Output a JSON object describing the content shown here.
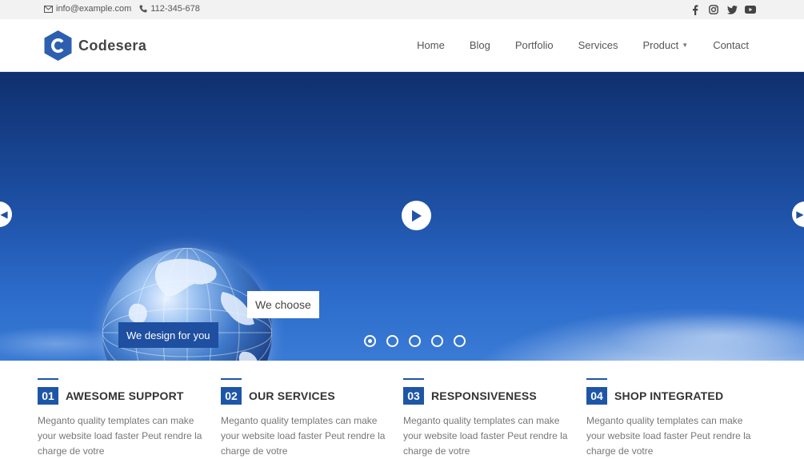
{
  "topbar": {
    "email": "info@example.com",
    "phone": "112-345-678",
    "social_icons": [
      "facebook-icon",
      "instagram-icon",
      "twitter-icon",
      "youtube-icon"
    ]
  },
  "header": {
    "brand": "Codesera",
    "nav": [
      "Home",
      "Blog",
      "Portfolio",
      "Services",
      "Product",
      "Contact"
    ]
  },
  "hero": {
    "caption_top": "We choose",
    "caption_bottom": "We design for you",
    "slides": 5,
    "active_slide": 1
  },
  "features": [
    {
      "num": "01",
      "title": "AWESOME SUPPORT",
      "desc": "Meganto quality templates can make your website load faster Peut rendre la charge de votre"
    },
    {
      "num": "02",
      "title": "OUR SERVICES",
      "desc": "Meganto quality templates can make your website load faster Peut rendre la charge de votre"
    },
    {
      "num": "03",
      "title": "RESPONSIVENESS",
      "desc": "Meganto quality templates can make your website load faster Peut rendre la charge de votre"
    },
    {
      "num": "04",
      "title": "SHOP INTEGRATED",
      "desc": "Meganto quality templates can make your website load faster Peut rendre la charge de votre"
    }
  ],
  "colors": {
    "accent": "#1e56a7",
    "topbar_bg": "#f2f2f2",
    "text_dark": "#333333",
    "text_muted": "#777777"
  }
}
